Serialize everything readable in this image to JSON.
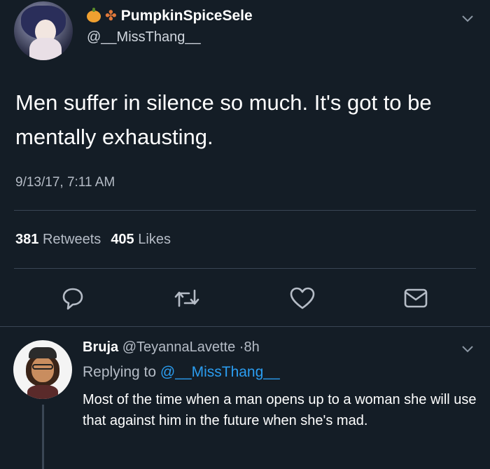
{
  "tweet": {
    "display_name": "PumpkinSpiceSele",
    "handle": "@__MissThang__",
    "text": "Men suffer in silence so much. It's got to be mentally exhausting.",
    "timestamp": "9/13/17, 7:11 AM",
    "retweets_count": "381",
    "retweets_label": "Retweets",
    "likes_count": "405",
    "likes_label": "Likes"
  },
  "reply": {
    "display_name": "Bruja",
    "handle": "@TeyannaLavette",
    "separator": "·",
    "time": "8h",
    "replying_prefix": "Replying to",
    "replying_mention": "@__MissThang__",
    "text": "Most of the time when a man opens up to a woman she will use that against him in the future when she's mad."
  },
  "colors": {
    "background": "#141d26",
    "muted_text": "#b5bcc6",
    "link": "#2b9df0",
    "divider": "#3a4654"
  },
  "icons": [
    "chevron-down-icon",
    "reply-icon",
    "retweet-icon",
    "heart-icon",
    "share-icon"
  ]
}
